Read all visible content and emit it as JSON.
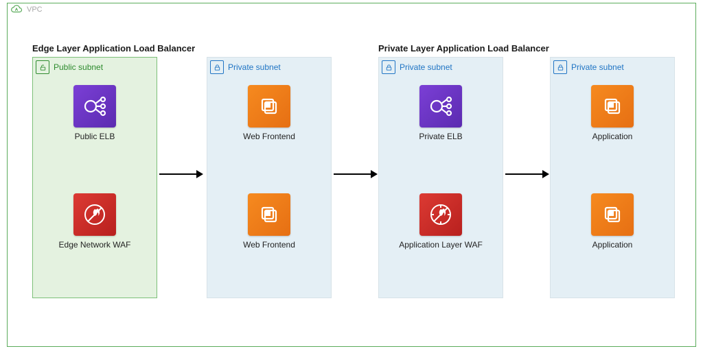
{
  "vpc_label": "VPC",
  "titles": {
    "left": "Edge Layer Application Load Balancer",
    "right": "Private Layer Application Load Balancer"
  },
  "subnet_labels": {
    "public": "Public subnet",
    "private": "Private subnet"
  },
  "col1": {
    "top": "Public ELB",
    "bottom": "Edge Network WAF"
  },
  "col2": {
    "top": "Web Frontend",
    "bottom": "Web Frontend"
  },
  "col3": {
    "top": "Private ELB",
    "bottom": "Application Layer WAF"
  },
  "col4": {
    "top": "Application",
    "bottom": "Application"
  }
}
